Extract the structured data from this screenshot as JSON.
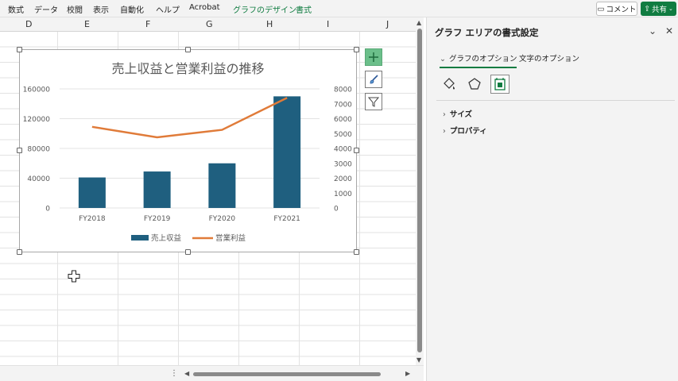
{
  "menu": {
    "items": [
      "数式",
      "データ",
      "校閲",
      "表示",
      "自動化",
      "ヘルプ",
      "Acrobat",
      "グラフのデザイン",
      "書式"
    ],
    "comment_label": "コメント",
    "share_label": "共有"
  },
  "sheet": {
    "columns": [
      "D",
      "E",
      "F",
      "G",
      "H",
      "I",
      "J"
    ]
  },
  "chart_data": {
    "type": "bar",
    "title": "売上収益と営業利益の推移",
    "categories": [
      "FY2018",
      "FY2019",
      "FY2020",
      "FY2021"
    ],
    "series": [
      {
        "name": "売上収益",
        "kind": "bar",
        "axis": "primary",
        "color": "#1f5f7f",
        "values": [
          41000,
          49000,
          60000,
          150000
        ]
      },
      {
        "name": "営業利益",
        "kind": "line",
        "axis": "secondary",
        "color": "#e07b39",
        "values": [
          5450,
          4750,
          5250,
          7400
        ]
      }
    ],
    "primary_axis": {
      "ylim": [
        0,
        160000
      ],
      "ticks": [
        "0",
        "40000",
        "80000",
        "120000",
        "160000"
      ]
    },
    "secondary_axis": {
      "ylim": [
        0,
        8000
      ],
      "ticks": [
        "0",
        "1000",
        "2000",
        "3000",
        "4000",
        "5000",
        "6000",
        "7000",
        "8000"
      ]
    },
    "grid": true,
    "legend": "bottom"
  },
  "pane": {
    "title": "グラフ エリアの書式設定",
    "tab_chart_options": "グラフのオプション",
    "tab_text_options": "文字のオプション",
    "sections": [
      "サイズ",
      "プロパティ"
    ]
  },
  "colors": {
    "accent": "#107c41",
    "bar": "#1f5f7f",
    "line": "#e07b39"
  }
}
